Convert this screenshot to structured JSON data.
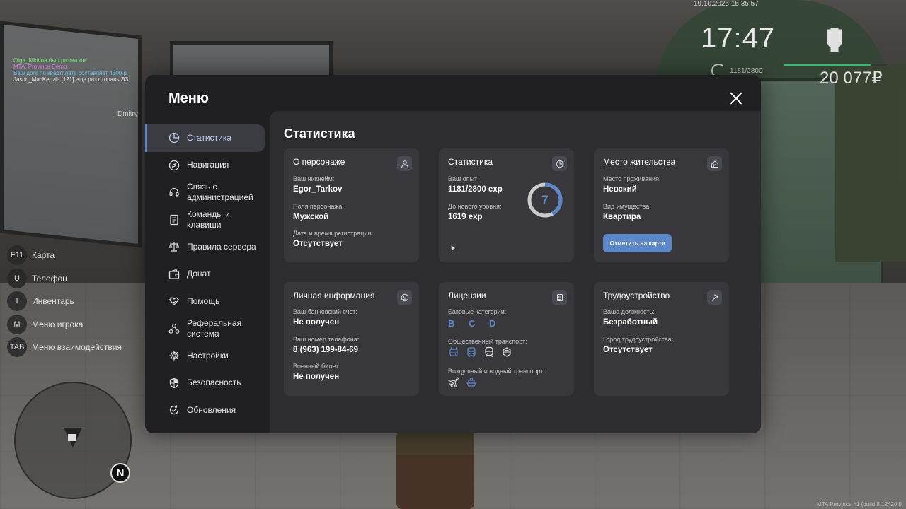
{
  "hud": {
    "chat": [
      "Olga_Nikitina был разочтюн!",
      "MTA: Province Demo",
      "Ваш долг по квартплате составляет 4300 р.",
      "Jason_MacKenzie [121] еще раз отправь ЭЗ"
    ],
    "nearby_name": "Dmitry",
    "date": "19.10.2025 15:35:57",
    "time": "17:47",
    "exp": "1181/2800",
    "money": "20 077₽",
    "build": "MTA Province #1 (build 8.12420.9",
    "keys": [
      {
        "key": "F11",
        "label": "Карта"
      },
      {
        "key": "U",
        "label": "Телефон"
      },
      {
        "key": "I",
        "label": "Инвентарь"
      },
      {
        "key": "M",
        "label": "Меню игрока"
      },
      {
        "key": "TAB",
        "label": "Меню взаимодействия"
      }
    ],
    "radar_north": "N"
  },
  "menu": {
    "title": "Меню",
    "nav": [
      {
        "label": "Статистика",
        "icon": "pie-chart-icon",
        "active": true
      },
      {
        "label": "Навигация",
        "icon": "compass-icon"
      },
      {
        "label": "Связь с\nадминистрацией",
        "icon": "headset-icon"
      },
      {
        "label": "Команды и\nклавиши",
        "icon": "document-icon"
      },
      {
        "label": "Правила сервера",
        "icon": "scales-icon"
      },
      {
        "label": "Донат",
        "icon": "wallet-icon"
      },
      {
        "label": "Помощь",
        "icon": "handshake-icon"
      },
      {
        "label": "Реферальная\nсистема",
        "icon": "network-icon"
      },
      {
        "label": "Настройки",
        "icon": "gear-icon"
      },
      {
        "label": "Безопасность",
        "icon": "shield-icon"
      },
      {
        "label": "Обновления",
        "icon": "refresh-check-icon"
      }
    ]
  },
  "content": {
    "title": "Статистика",
    "character": {
      "title": "О персонаже",
      "icon": "user-icon",
      "nick_label": "Ваш никнейм:",
      "nick": "Egor_Tarkov",
      "sex_label": "Поля персонажа:",
      "sex": "Мужской",
      "reg_label": "Дата и время регистрации:",
      "reg": "Отсутствует"
    },
    "stats": {
      "title": "Статистика",
      "icon": "pie-chart-icon",
      "exp_label": "Ваш опыт:",
      "exp": "1181/2800 exp",
      "next_label": "До нового уровня:",
      "next": "1619 exp",
      "level": "7",
      "progress": 0.42
    },
    "residence": {
      "title": "Место жительства",
      "icon": "home-icon",
      "place_label": "Место проживания:",
      "place": "Невский",
      "type_label": "Вид имущества:",
      "type": "Квартира",
      "button": "Отметить на карте"
    },
    "personal": {
      "title": "Личная информация",
      "icon": "user-circle-icon",
      "bank_label": "Ваш банковский счет:",
      "bank": "Не получен",
      "phone_label": "Ваш номер телефона:",
      "phone": "8 (963) 199-84-69",
      "military_label": "Военный билет:",
      "military": "Не получен"
    },
    "licenses": {
      "title": "Лицензии",
      "icon": "badge-icon",
      "base_label": "Базовые категории:",
      "base": "B C D",
      "public_label": "Общественный транспорт:",
      "public_icons": [
        "trolleybus-icon",
        "bus-icon",
        "train-icon",
        "tram-icon"
      ],
      "air_label": "Воздушный и водный транспорт:",
      "air_icons": [
        "plane-icon",
        "boat-icon"
      ]
    },
    "job": {
      "title": "Трудоустройство",
      "icon": "pickaxe-icon",
      "position_label": "Ваша должность:",
      "position": "Безработный",
      "city_label": "Город трудоустройства:",
      "city": "Отсутствует"
    }
  },
  "colors": {
    "accent": "#5b86c8",
    "panel": "#202022",
    "content_bg": "#2d2d30",
    "card_bg": "#38383c"
  }
}
